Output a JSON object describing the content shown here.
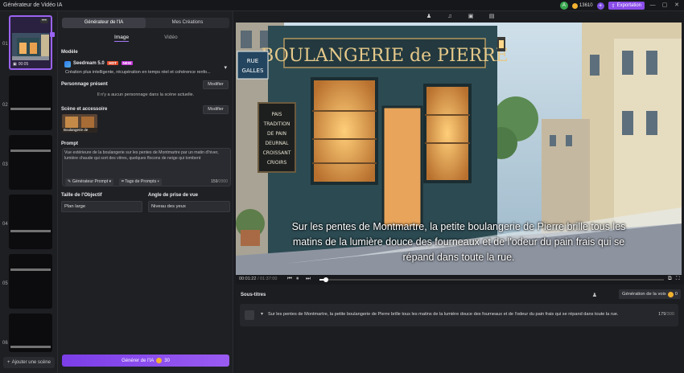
{
  "app": {
    "title": "Générateur de Vidéo IA",
    "avatar_letter": "A",
    "credits": "13610",
    "export_label": "Exportation"
  },
  "scenes": [
    {
      "num": "01",
      "duration": "00:05"
    },
    {
      "num": "02"
    },
    {
      "num": "03"
    },
    {
      "num": "04"
    },
    {
      "num": "05"
    },
    {
      "num": "06"
    }
  ],
  "add_scene_label": "Ajouter une scène",
  "panel": {
    "tabs": [
      "Générateur de l'IA",
      "Mes Créations"
    ],
    "subtabs": [
      "Image",
      "Vidéo"
    ],
    "model_label": "Modèle",
    "model_name": "Seedream 5.0",
    "model_badge_hot": "HOT",
    "model_badge_new": "NEW",
    "model_desc": "Création plus intelligente, récupération en temps réel et cohérence renfo...",
    "character_label": "Personnage présent",
    "modify_label": "Modifier",
    "character_note": "Il n'y a aucun personnage dans la scène actuelle.",
    "scene_label": "Scène et accessoire",
    "scene_caption": "Boulangerie de",
    "prompt_label": "Prompt",
    "prompt_text": "Vue extérieure de la boulangerie sur les pentes de Montmartre par un matin d'hiver, lumière chaude qui sort des vitres, quelques flocons de neige qui tombent",
    "prompt_generator": "Générateur Prompt",
    "prompt_tags": "Tags de Prompts",
    "prompt_count": "159",
    "prompt_max": "/2000",
    "lens_label": "Taille de l'Objectif",
    "lens_value": "Plan large",
    "angle_label": "Angle de prise de vue",
    "angle_value": "Niveau des yeux",
    "generate_label": "Générer de l'IA",
    "generate_cost": "30"
  },
  "preview": {
    "sign": "BOULANGERIE de PIERRE",
    "street_sign": "RUE DES GALLES",
    "menu_board": [
      "PAIS",
      "TRADITION",
      "DE PAIN",
      "DEURNAL",
      "CROISSANT",
      "CRIOIRS"
    ],
    "caption_lines": [
      "Sur les pentes de Montmartre, la petite boulangerie de Pierre brille tous les",
      "matins de la lumière douce des fourneaux et de l'odeur du pain frais qui se",
      "répand dans toute la rue."
    ]
  },
  "player": {
    "current": "00:01:22",
    "total": "/ 01:37:00",
    "progress": 0.019
  },
  "subtitles": {
    "label": "Sous-titres",
    "voice_button": "Génération de la voix",
    "voice_cost": "0",
    "text": "Sur les pentes de Montmartre, la petite boulangerie de Pierre brille tous les matins de la lumière douce des fourneaux et de l'odeur du pain frais qui se répand dans toute la rue.",
    "count": "179",
    "max": "/300"
  },
  "colors": {
    "accent": "#8a4dea",
    "storefront": "#2c4a52",
    "warm_light": "#f2b160"
  }
}
